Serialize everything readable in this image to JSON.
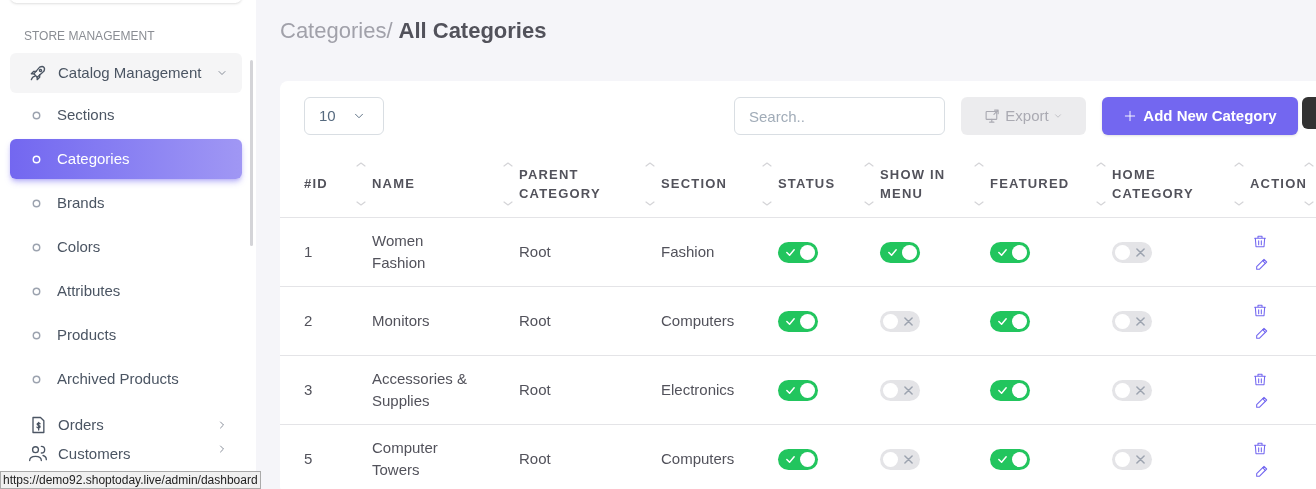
{
  "sidebar": {
    "section_title": "STORE MANAGEMENT",
    "items": [
      {
        "label": "Catalog Management",
        "expanded": true,
        "children": [
          {
            "label": "Sections",
            "selected": false
          },
          {
            "label": "Categories",
            "selected": true
          },
          {
            "label": "Brands",
            "selected": false
          },
          {
            "label": "Colors",
            "selected": false
          },
          {
            "label": "Attributes",
            "selected": false
          },
          {
            "label": "Products",
            "selected": false
          },
          {
            "label": "Archived Products",
            "selected": false
          }
        ]
      },
      {
        "label": "Orders",
        "expanded": false
      },
      {
        "label": "Customers",
        "expanded": false
      }
    ]
  },
  "breadcrumb": {
    "parent": "Categories/",
    "current": "All Categories"
  },
  "toolbar": {
    "page_size": "10",
    "search": {
      "placeholder": "Search.."
    },
    "export_button": "Export",
    "add_button": "Add New Category"
  },
  "table": {
    "columns": [
      "#ID",
      "NAME",
      "PARENT CATEGORY",
      "SECTION",
      "STATUS",
      "SHOW IN MENU",
      "FEATURED",
      "HOME CATEGORY",
      "ACTION"
    ],
    "rows": [
      {
        "id": "1",
        "name": "Women Fashion",
        "parent": "Root",
        "section": "Fashion",
        "status": true,
        "show_in_menu": true,
        "featured": true,
        "home_category": false
      },
      {
        "id": "2",
        "name": "Monitors",
        "parent": "Root",
        "section": "Computers",
        "status": true,
        "show_in_menu": false,
        "featured": true,
        "home_category": false
      },
      {
        "id": "3",
        "name": "Accessories & Supplies",
        "parent": "Root",
        "section": "Electronics",
        "status": true,
        "show_in_menu": false,
        "featured": true,
        "home_category": false
      },
      {
        "id": "5",
        "name": "Computer Towers",
        "parent": "Root",
        "section": "Computers",
        "status": true,
        "show_in_menu": false,
        "featured": true,
        "home_category": false
      }
    ]
  },
  "status_bar": {
    "url": "https://demo92.shoptoday.live/admin/dashboard"
  }
}
